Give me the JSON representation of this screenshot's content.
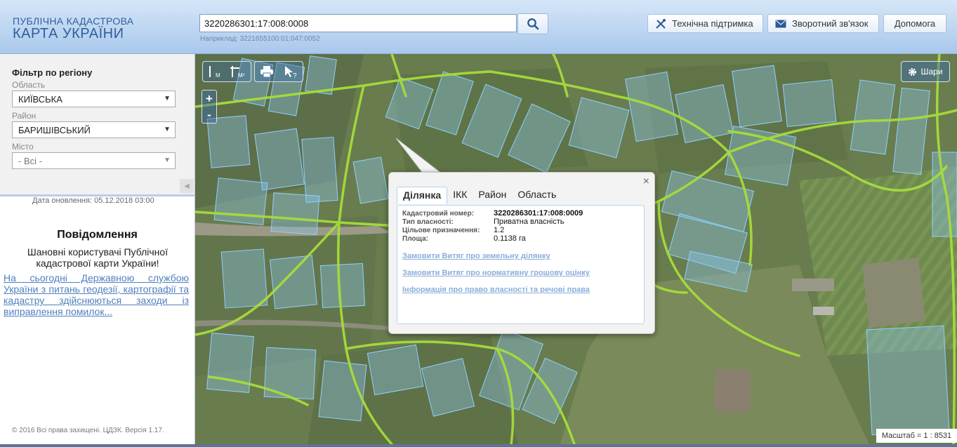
{
  "logo": {
    "line1": "ПУБЛІЧНА КАДАСТРОВА",
    "line2": "КАРТА УКРАЇНИ"
  },
  "search": {
    "value": "3220286301:17:008:0008",
    "example": "Наприклад: 3221655100:01:047:0052",
    "icon": "search-icon"
  },
  "header_buttons": [
    {
      "label": "Технічна підтримка",
      "icon": "tools-icon"
    },
    {
      "label": "Зворотний зв'язок",
      "icon": "envelope-icon"
    },
    {
      "label": "Допомога"
    }
  ],
  "filter": {
    "title": "Фільтр по регіону",
    "oblast": {
      "label": "Область",
      "value": "КИЇВСЬКА"
    },
    "raion": {
      "label": "Район",
      "value": "БАРИШІВСЬКИЙ"
    },
    "misto": {
      "label": "Місто",
      "value": "- Всі -"
    }
  },
  "update_date": "Дата оновлення: 05.12.2018 03:00",
  "notice": {
    "title": "Повідомлення",
    "text": "Шановні користувачі Публічної кадастрової карти України!",
    "link": "На сьогодні Державною службою України з питань геодезії, картографії та кадастру здійснюються заходи із виправлення помилок..."
  },
  "copyright": "© 2016 Всі права захищені. ЦДЗК. Версія 1.17.",
  "map": {
    "tools": [
      {
        "label": "М",
        "icon": "measure-distance-icon"
      },
      {
        "label": "М²",
        "icon": "measure-area-icon"
      },
      {
        "label": "",
        "icon": "print-icon"
      },
      {
        "label": "?",
        "icon": "identify-icon"
      }
    ],
    "zoom_in": "+",
    "zoom_out": "-",
    "layers_label": "Шари",
    "scale": "Масштаб = 1 : 8531"
  },
  "popup": {
    "tabs": [
      "Ділянка",
      "ІКК",
      "Район",
      "Область"
    ],
    "active_tab": "Ділянка",
    "fields": [
      {
        "key": "Кадастровий номер:",
        "value": "3220286301:17:008:0009"
      },
      {
        "key": "Тип власності:",
        "value": "Приватна власність"
      },
      {
        "key": "Цільове призначення:",
        "value": "1.2"
      },
      {
        "key": "Площа:",
        "value": "0.1138 га"
      }
    ],
    "links": [
      "Замовити Витяг про земельну ділянку",
      "Замовити Витяг про нормативну грошову оцінку",
      "Інформація про право власності та речові права"
    ],
    "close": "×"
  },
  "colors": {
    "header_bg": "#b9d3f0",
    "parcel_fill": "#8cc8f0",
    "boundary_green": "#9fd640",
    "link": "#4f7fc0"
  }
}
